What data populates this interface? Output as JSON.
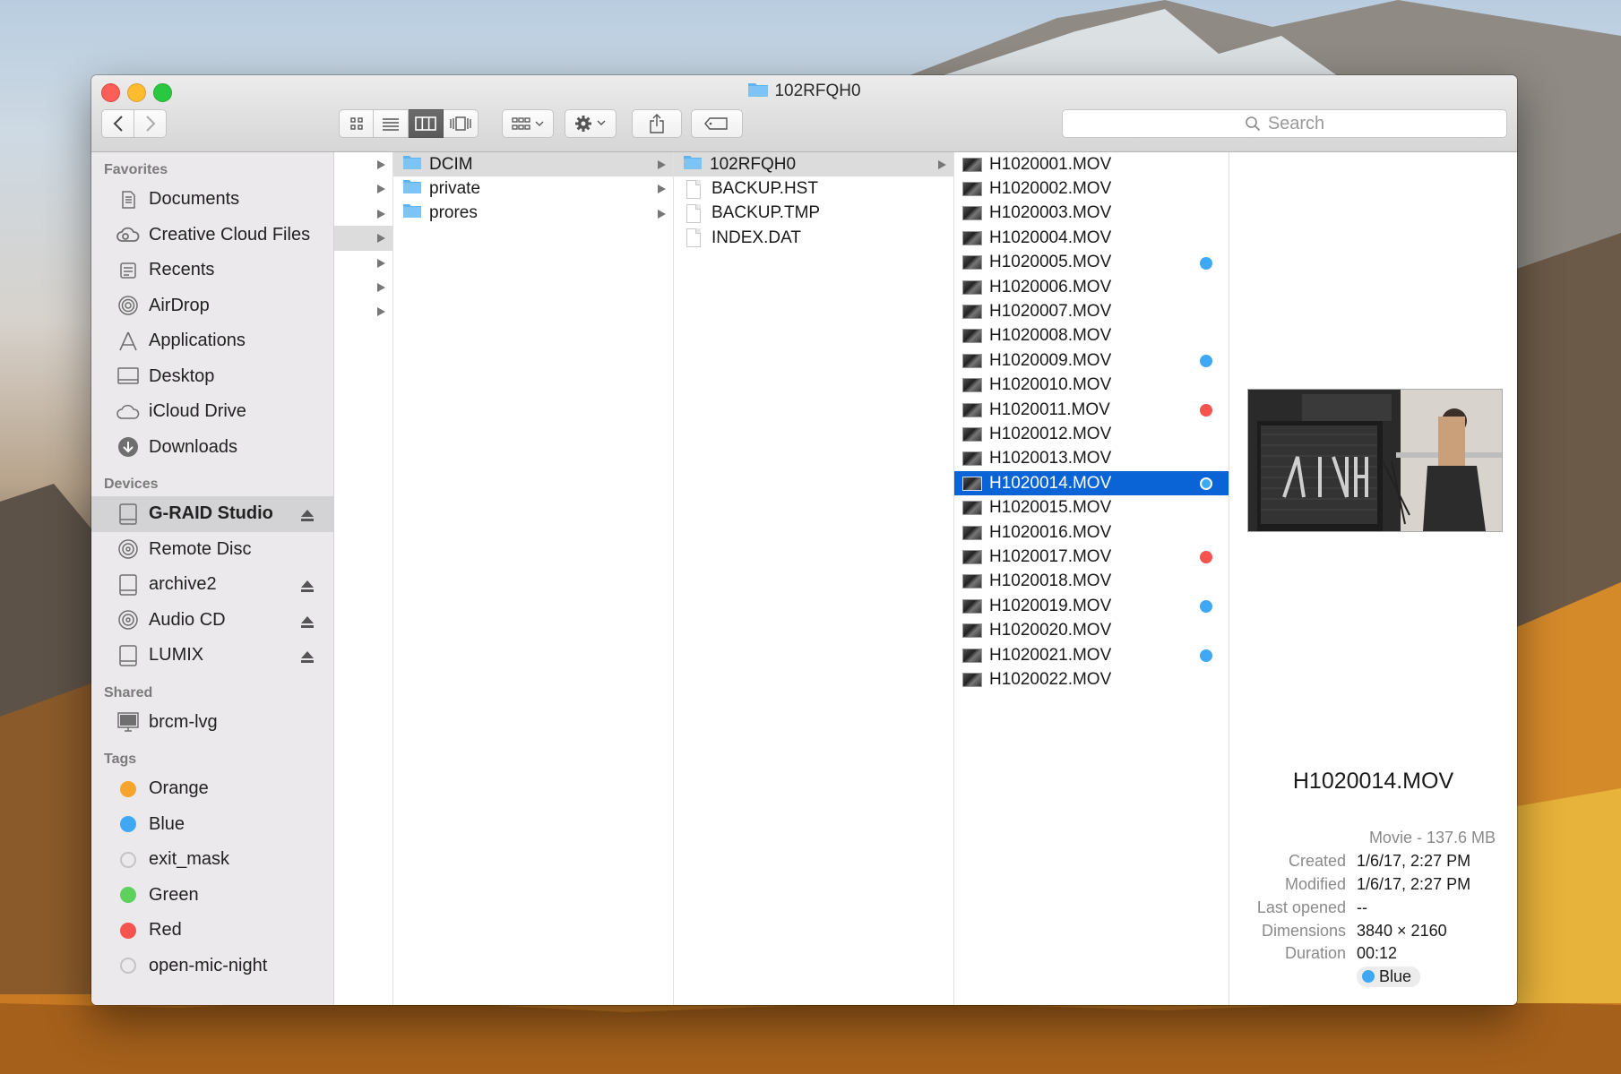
{
  "colors": {
    "selection": "#0a64d6",
    "blue_tag": "#3fa8f4",
    "red_tag": "#f5534e",
    "orange_tag": "#f7a42e",
    "green_tag": "#5cd15b",
    "grey_tag": "#c9c9c9",
    "folder": "#5fb4f0"
  },
  "window": {
    "title": "102RFQH0"
  },
  "toolbar": {
    "search_placeholder": "Search"
  },
  "sidebar": {
    "favorites_title": "Favorites",
    "favorites": [
      {
        "label": "Documents",
        "icon": "documents-icon"
      },
      {
        "label": "Creative Cloud Files",
        "icon": "creative-cloud-icon"
      },
      {
        "label": "Recents",
        "icon": "recents-icon"
      },
      {
        "label": "AirDrop",
        "icon": "airdrop-icon"
      },
      {
        "label": "Applications",
        "icon": "applications-icon"
      },
      {
        "label": "Desktop",
        "icon": "desktop-icon"
      },
      {
        "label": "iCloud Drive",
        "icon": "icloud-icon"
      },
      {
        "label": "Downloads",
        "icon": "downloads-icon"
      }
    ],
    "devices_title": "Devices",
    "devices": [
      {
        "label": "G-RAID Studio",
        "eject": true,
        "selected": true,
        "icon": "drive-icon"
      },
      {
        "label": "Remote Disc",
        "eject": false,
        "icon": "disc-icon"
      },
      {
        "label": "archive2",
        "eject": true,
        "icon": "drive-icon"
      },
      {
        "label": "Audio CD",
        "eject": true,
        "icon": "disc-icon"
      },
      {
        "label": "LUMIX",
        "eject": true,
        "icon": "drive-icon"
      }
    ],
    "shared_title": "Shared",
    "shared": [
      {
        "label": "brcm-lvg",
        "icon": "computer-icon"
      }
    ],
    "tags_title": "Tags",
    "tags": [
      {
        "label": "Orange",
        "color": "#f7a42e"
      },
      {
        "label": "Blue",
        "color": "#3fa8f4"
      },
      {
        "label": "exit_mask",
        "color": "#d8d8d8"
      },
      {
        "label": "Green",
        "color": "#5cd15b"
      },
      {
        "label": "Red",
        "color": "#f5534e"
      },
      {
        "label": "open-mic-night",
        "color": "#d8d8d8"
      }
    ]
  },
  "columns": {
    "col1_arrow_rows": 7,
    "col1_selected_row": 3,
    "col2": [
      {
        "label": "DCIM",
        "type": "folder",
        "selected": true
      },
      {
        "label": "private",
        "type": "folder"
      },
      {
        "label": "prores",
        "type": "folder"
      }
    ],
    "col3": [
      {
        "label": "102RFQH0",
        "type": "folder",
        "selected": true
      },
      {
        "label": "BACKUP.HST",
        "type": "doc"
      },
      {
        "label": "BACKUP.TMP",
        "type": "doc"
      },
      {
        "label": "INDEX.DAT",
        "type": "doc"
      }
    ],
    "files": [
      {
        "label": "H1020001.MOV"
      },
      {
        "label": "H1020002.MOV"
      },
      {
        "label": "H1020003.MOV"
      },
      {
        "label": "H1020004.MOV"
      },
      {
        "label": "H1020005.MOV",
        "tag": "#3fa8f4"
      },
      {
        "label": "H1020006.MOV"
      },
      {
        "label": "H1020007.MOV"
      },
      {
        "label": "H1020008.MOV"
      },
      {
        "label": "H1020009.MOV",
        "tag": "#3fa8f4"
      },
      {
        "label": "H1020010.MOV"
      },
      {
        "label": "H1020011.MOV",
        "tag": "#f5534e"
      },
      {
        "label": "H1020012.MOV"
      },
      {
        "label": "H1020013.MOV"
      },
      {
        "label": "H1020014.MOV",
        "tag": "#3fa8f4",
        "selected": true
      },
      {
        "label": "H1020015.MOV"
      },
      {
        "label": "H1020016.MOV"
      },
      {
        "label": "H1020017.MOV",
        "tag": "#f5534e"
      },
      {
        "label": "H1020018.MOV"
      },
      {
        "label": "H1020019.MOV",
        "tag": "#3fa8f4"
      },
      {
        "label": "H1020020.MOV"
      },
      {
        "label": "H1020021.MOV",
        "tag": "#3fa8f4"
      },
      {
        "label": "H1020022.MOV"
      }
    ]
  },
  "preview": {
    "filename": "H1020014.MOV",
    "kind": "Movie - 137.6 MB",
    "rows": [
      {
        "key": "Created",
        "value": "1/6/17, 2:27 PM"
      },
      {
        "key": "Modified",
        "value": "1/6/17, 2:27 PM"
      },
      {
        "key": "Last opened",
        "value": "--"
      },
      {
        "key": "Dimensions",
        "value": "3840 × 2160"
      },
      {
        "key": "Duration",
        "value": "00:12"
      }
    ],
    "tag_label": "Blue",
    "tag_color": "#3fa8f4"
  }
}
